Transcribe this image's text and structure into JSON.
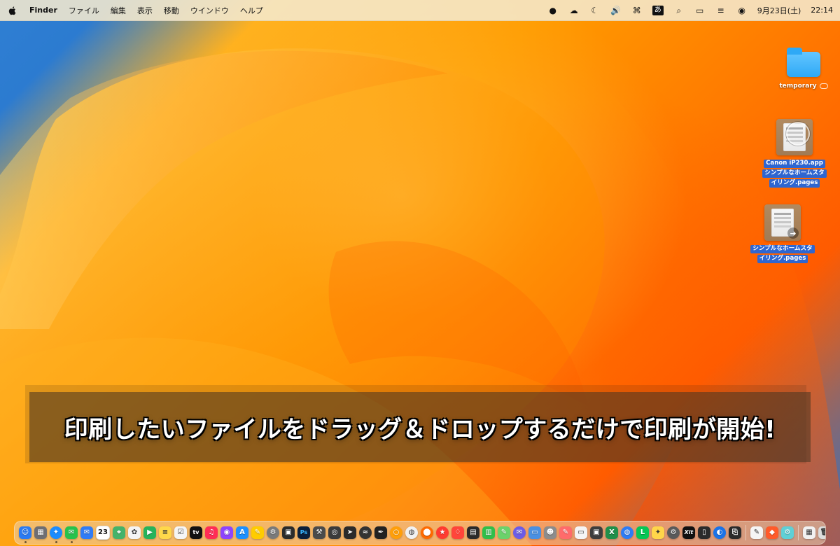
{
  "menubar": {
    "apple_icon": "apple-icon",
    "app_name": "Finder",
    "menus": [
      "ファイル",
      "編集",
      "表示",
      "移動",
      "ウインドウ",
      "ヘルプ"
    ],
    "status_icons": [
      {
        "name": "record-icon",
        "glyph": "●"
      },
      {
        "name": "cloud-upload-icon",
        "glyph": "☁"
      },
      {
        "name": "moon-icon",
        "glyph": "☾"
      },
      {
        "name": "volume-icon",
        "glyph": "🔊"
      },
      {
        "name": "command-icon",
        "glyph": "⌘"
      },
      {
        "name": "input-method-icon",
        "glyph": "あ"
      },
      {
        "name": "search-icon",
        "glyph": "⌕"
      },
      {
        "name": "battery-icon",
        "glyph": "▭"
      },
      {
        "name": "control-center-icon",
        "glyph": "≡"
      },
      {
        "name": "siri-icon",
        "glyph": "◉"
      }
    ],
    "date": "9月23日(土)",
    "time": "22:14"
  },
  "desktop": {
    "folder": {
      "name": "temporary"
    },
    "drag_group": {
      "line1": "Canon iP230.app",
      "line2": "シンプルなホームスタ",
      "line3": "イリング.pages"
    },
    "file2": {
      "line1": "シンプルなホームスタ",
      "line2": "イリング.pages"
    }
  },
  "caption": {
    "text": "印刷したいファイルをドラッグ＆ドロップするだけで印刷が開始!"
  },
  "dock": {
    "calendar_day": "23",
    "icons": [
      {
        "name": "finder-icon",
        "color": "#2b7bf3",
        "round": false,
        "running": true,
        "glyph": "☺"
      },
      {
        "name": "launchpad-icon",
        "color": "#6e6e73",
        "round": false,
        "running": false,
        "glyph": "▦"
      },
      {
        "name": "safari-icon",
        "color": "#1a8cff",
        "round": true,
        "running": true,
        "glyph": "✦"
      },
      {
        "name": "messages-icon",
        "color": "#27c24c",
        "round": false,
        "running": true,
        "glyph": "✉"
      },
      {
        "name": "mail-icon",
        "color": "#2f7cf6",
        "round": false,
        "running": false,
        "glyph": "✉"
      },
      {
        "name": "calendar-icon",
        "color": "#ffffff",
        "round": false,
        "running": false,
        "glyph": ""
      },
      {
        "name": "maps-icon",
        "color": "#44b36a",
        "round": false,
        "running": false,
        "glyph": "⌖"
      },
      {
        "name": "photos-icon",
        "color": "#f4f4f4",
        "round": false,
        "running": false,
        "glyph": "✿"
      },
      {
        "name": "facetime-icon",
        "color": "#26b35b",
        "round": false,
        "running": false,
        "glyph": "▶"
      },
      {
        "name": "notes-icon",
        "color": "#ffd84a",
        "round": false,
        "running": false,
        "glyph": "≡"
      },
      {
        "name": "reminders-icon",
        "color": "#f5f5f5",
        "round": false,
        "running": false,
        "glyph": "☑"
      },
      {
        "name": "tv-icon",
        "color": "#111111",
        "round": false,
        "running": false,
        "glyph": "tv"
      },
      {
        "name": "music-icon",
        "color": "#ff2d55",
        "round": false,
        "running": false,
        "glyph": "♫"
      },
      {
        "name": "podcasts-icon",
        "color": "#8e44ff",
        "round": false,
        "running": false,
        "glyph": "◉"
      },
      {
        "name": "app-store-icon",
        "color": "#1e90ff",
        "round": false,
        "running": false,
        "glyph": "A"
      },
      {
        "name": "pencil-icon",
        "color": "#ffcc00",
        "round": false,
        "running": false,
        "glyph": "✎"
      },
      {
        "name": "settings-icon",
        "color": "#7a7a7a",
        "round": true,
        "running": false,
        "glyph": "⚙"
      },
      {
        "name": "film-icon",
        "color": "#2b2b2b",
        "round": false,
        "running": false,
        "glyph": "▣"
      },
      {
        "name": "photoshop-icon",
        "color": "#0b1f3a",
        "round": false,
        "running": false,
        "glyph": "Ps"
      },
      {
        "name": "tools-icon",
        "color": "#4b4b4b",
        "round": false,
        "running": false,
        "glyph": "⚒"
      },
      {
        "name": "screenshot-icon",
        "color": "#3b3b3b",
        "round": false,
        "running": false,
        "glyph": "◎"
      },
      {
        "name": "cursor-icon",
        "color": "#2b2b2b",
        "round": false,
        "running": false,
        "glyph": "➤"
      },
      {
        "name": "waves-icon",
        "color": "#333333",
        "round": true,
        "running": false,
        "glyph": "≈"
      },
      {
        "name": "pen-icon",
        "color": "#222222",
        "round": false,
        "running": false,
        "glyph": "✒"
      },
      {
        "name": "ring-icon",
        "color": "#ff9f0a",
        "round": true,
        "running": false,
        "glyph": "○"
      },
      {
        "name": "chrome-icon",
        "color": "#f1f1f1",
        "round": true,
        "running": false,
        "glyph": "◍"
      },
      {
        "name": "browser-icon",
        "color": "#ff6a00",
        "round": true,
        "running": false,
        "glyph": "⬤"
      },
      {
        "name": "star-icon",
        "color": "#ff3b30",
        "round": true,
        "running": false,
        "glyph": "★"
      },
      {
        "name": "drop-icon",
        "color": "#ff453a",
        "round": false,
        "running": false,
        "glyph": "♢"
      },
      {
        "name": "document-icon",
        "color": "#2b2b2b",
        "round": false,
        "running": false,
        "glyph": "▤"
      },
      {
        "name": "numbers-icon",
        "color": "#2fbf4a",
        "round": false,
        "running": false,
        "glyph": "▥"
      },
      {
        "name": "paint-icon",
        "color": "#6bd26b",
        "round": false,
        "running": false,
        "glyph": "✎"
      },
      {
        "name": "messenger-icon",
        "color": "#6c5ce7",
        "round": true,
        "running": false,
        "glyph": "✉"
      },
      {
        "name": "window-icon",
        "color": "#4a90e2",
        "round": false,
        "running": false,
        "glyph": "▭"
      },
      {
        "name": "mascot-icon",
        "color": "#8c8c8c",
        "round": false,
        "running": false,
        "glyph": "☻"
      },
      {
        "name": "art-icon",
        "color": "#ff6b6b",
        "round": false,
        "running": false,
        "glyph": "✎"
      },
      {
        "name": "slides-icon",
        "color": "#f5f5f5",
        "round": false,
        "running": false,
        "glyph": "▭"
      },
      {
        "name": "monitor-icon",
        "color": "#3d3d3d",
        "round": false,
        "running": false,
        "glyph": "▣"
      },
      {
        "name": "excel-icon",
        "color": "#1f8f4a",
        "round": false,
        "running": false,
        "glyph": "X"
      },
      {
        "name": "globe-icon",
        "color": "#2d7cf6",
        "round": true,
        "running": false,
        "glyph": "◍"
      },
      {
        "name": "line-icon",
        "color": "#06c755",
        "round": false,
        "running": false,
        "glyph": "L"
      },
      {
        "name": "bulb-icon",
        "color": "#ffd54a",
        "round": false,
        "running": false,
        "glyph": "✦"
      },
      {
        "name": "gear2-icon",
        "color": "#5a5a5a",
        "round": true,
        "running": false,
        "glyph": "⚙"
      },
      {
        "name": "xit-icon",
        "color": "#111111",
        "round": false,
        "running": false,
        "glyph": "Xit"
      },
      {
        "name": "phone-icon",
        "color": "#2b2b2b",
        "round": false,
        "running": false,
        "glyph": "▯"
      },
      {
        "name": "speed-icon",
        "color": "#1a73e8",
        "round": true,
        "running": false,
        "glyph": "◐"
      },
      {
        "name": "save-icon",
        "color": "#2b2b2b",
        "round": false,
        "running": false,
        "glyph": "⎘"
      },
      {
        "name": "separator-1",
        "separator": true
      },
      {
        "name": "textedit-icon",
        "color": "#f5f5f5",
        "round": false,
        "running": false,
        "glyph": "✎"
      },
      {
        "name": "brave-icon",
        "color": "#ff5a2a",
        "round": false,
        "running": false,
        "glyph": "◆"
      },
      {
        "name": "utilities-icon",
        "color": "#5fd0d6",
        "round": false,
        "running": false,
        "glyph": "⚙"
      },
      {
        "name": "separator-2",
        "separator": true
      },
      {
        "name": "downloads-icon",
        "color": "#f1f1f1",
        "round": false,
        "running": false,
        "glyph": "▦"
      },
      {
        "name": "trash-icon",
        "color": "#dcdcdc",
        "round": false,
        "running": false,
        "glyph": "🗑"
      }
    ]
  }
}
